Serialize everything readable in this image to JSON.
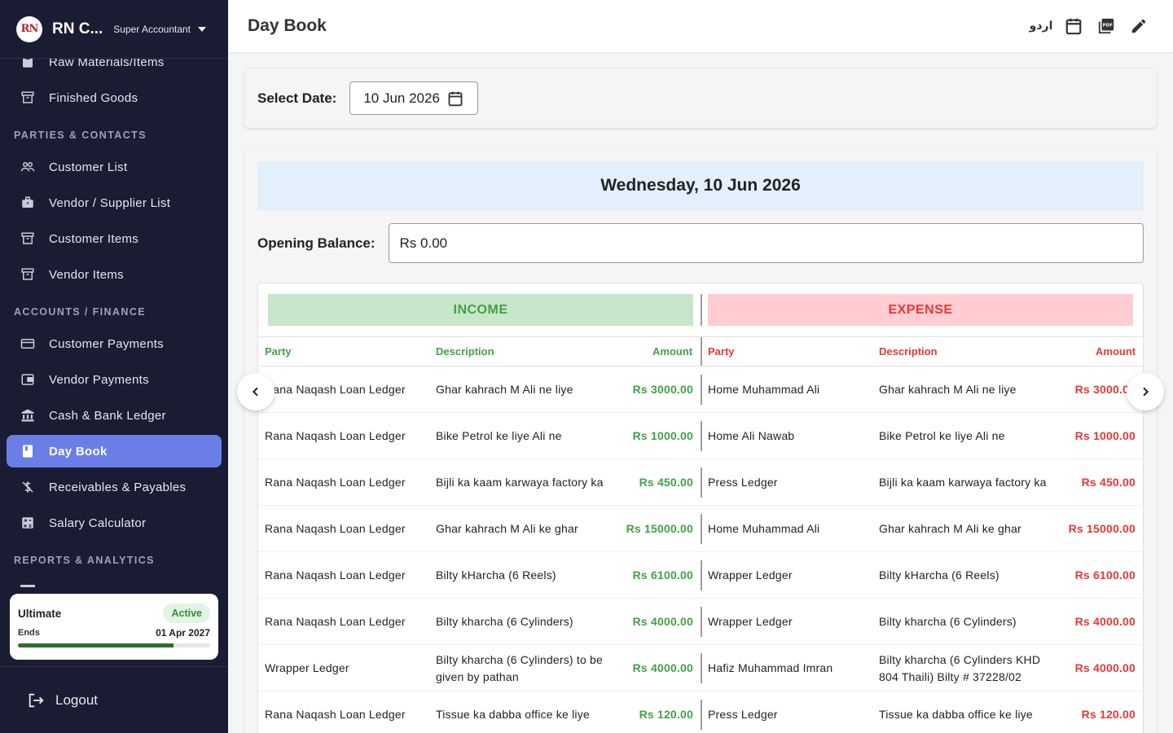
{
  "brand": {
    "logo_text": "RN",
    "name": "RN C...",
    "role": "Super Accountant"
  },
  "sidebar": {
    "items_top": [
      {
        "label": "Raw Materials/Items",
        "icon": "box-icon"
      },
      {
        "label": "Finished Goods",
        "icon": "archive-icon"
      }
    ],
    "sections": [
      {
        "label": "PARTIES & CONTACTS"
      },
      {
        "label": "ACCOUNTS / FINANCE"
      },
      {
        "label": "REPORTS & ANALYTICS"
      }
    ],
    "items_parties": [
      {
        "label": "Customer List",
        "icon": "people-icon"
      },
      {
        "label": "Vendor / Supplier List",
        "icon": "briefcase-icon"
      },
      {
        "label": "Customer Items",
        "icon": "archive-icon"
      },
      {
        "label": "Vendor Items",
        "icon": "archive-icon"
      }
    ],
    "items_finance": [
      {
        "label": "Customer Payments",
        "icon": "credit-card-icon"
      },
      {
        "label": "Vendor Payments",
        "icon": "wallet-icon"
      },
      {
        "label": "Cash & Bank Ledger",
        "icon": "bank-icon"
      },
      {
        "label": "Day Book",
        "icon": "book-icon",
        "active": true
      },
      {
        "label": "Receivables & Payables",
        "icon": "money-off-icon"
      },
      {
        "label": "Salary Calculator",
        "icon": "calculator-icon"
      }
    ],
    "plan": {
      "name": "Ultimate",
      "status": "Active",
      "ends_label": "Ends",
      "ends_date": "01 Apr 2027",
      "progress": 0.81
    },
    "logout": "Logout"
  },
  "header": {
    "title": "Day Book",
    "lang_toggle": "اردو"
  },
  "filter": {
    "label": "Select Date:",
    "date_value": "10 Jun 2026"
  },
  "daybook": {
    "day_title": "Wednesday, 10 Jun 2026",
    "opening_balance_label": "Opening Balance:",
    "opening_balance_value": "Rs 0.00",
    "income_title": "INCOME",
    "expense_title": "EXPENSE",
    "columns": {
      "party": "Party",
      "description": "Description",
      "amount": "Amount"
    },
    "rows": [
      {
        "in_party": "Rana Naqash Loan Ledger",
        "in_desc": "Ghar kahrach M Ali ne liye",
        "in_amt": "Rs 3000.00",
        "ex_party": "Home Muhammad Ali",
        "ex_desc": "Ghar kahrach M Ali ne liye",
        "ex_amt": "Rs 3000.00"
      },
      {
        "in_party": "Rana Naqash Loan Ledger",
        "in_desc": "Bike Petrol ke liye Ali ne",
        "in_amt": "Rs 1000.00",
        "ex_party": "Home Ali Nawab",
        "ex_desc": "Bike Petrol ke liye Ali ne",
        "ex_amt": "Rs 1000.00"
      },
      {
        "in_party": "Rana Naqash Loan Ledger",
        "in_desc": "Bijli ka kaam karwaya factory ka",
        "in_amt": "Rs 450.00",
        "ex_party": "Press Ledger",
        "ex_desc": "Bijli ka kaam karwaya factory ka",
        "ex_amt": "Rs 450.00"
      },
      {
        "in_party": "Rana Naqash Loan Ledger",
        "in_desc": "Ghar kahrach M Ali ke ghar",
        "in_amt": "Rs 15000.00",
        "ex_party": "Home Muhammad Ali",
        "ex_desc": "Ghar kahrach M Ali ke ghar",
        "ex_amt": "Rs 15000.00"
      },
      {
        "in_party": "Rana Naqash Loan Ledger",
        "in_desc": "Bilty kHarcha (6 Reels)",
        "in_amt": "Rs 6100.00",
        "ex_party": "Wrapper Ledger",
        "ex_desc": "Bilty kHarcha (6 Reels)",
        "ex_amt": "Rs 6100.00"
      },
      {
        "in_party": "Rana Naqash Loan Ledger",
        "in_desc": "Bilty kharcha (6 Cylinders)",
        "in_amt": "Rs 4000.00",
        "ex_party": "Wrapper Ledger",
        "ex_desc": "Bilty kharcha (6 Cylinders)",
        "ex_amt": "Rs 4000.00"
      },
      {
        "in_party": "Wrapper Ledger",
        "in_desc": "Bilty kharcha (6 Cylinders) to be given by pathan",
        "in_amt": "Rs 4000.00",
        "ex_party": "Hafiz Muhammad Imran",
        "ex_desc": "Bilty kharcha (6 Cylinders KHD 804 Thaili) Bilty # 37228/02",
        "ex_amt": "Rs 4000.00"
      },
      {
        "in_party": "Rana Naqash Loan Ledger",
        "in_desc": "Tissue ka dabba office ke liye",
        "in_amt": "Rs 120.00",
        "ex_party": "Press Ledger",
        "ex_desc": "Tissue ka dabba office ke liye",
        "ex_amt": "Rs 120.00"
      }
    ]
  }
}
